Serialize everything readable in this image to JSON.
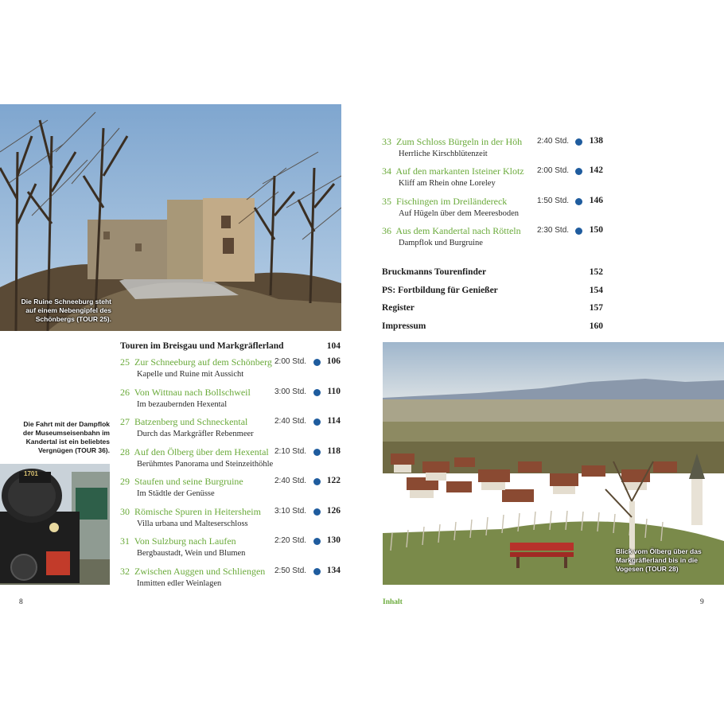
{
  "captions": {
    "ruine": "Die Ruine Schneeburg steht auf einem Nebengipfel des Schönbergs (TOUR 25).",
    "dampflok": "Die Fahrt mit der Dampflok der Museumseisenbahn im Kandertal ist ein beliebtes Vergnügen (TOUR 36).",
    "oelberg": "Blick vom Ölberg über das Markgräflerland bis in die Vogesen (TOUR 28)",
    "loco_number": "1701"
  },
  "left": {
    "section": {
      "title": "Touren im Breisgau und Markgräflerland",
      "page": "104"
    },
    "entries": [
      {
        "num": "25",
        "title": "Zur Schneeburg auf dem Schönberg",
        "subtitle": "Kapelle und Ruine mit Aussicht",
        "duration": "2:00 Std.",
        "page": "106"
      },
      {
        "num": "26",
        "title": "Von Wittnau nach Bollschweil",
        "subtitle": "Im bezaubernden Hexental",
        "duration": "3:00 Std.",
        "page": "110"
      },
      {
        "num": "27",
        "title": "Batzenberg und Schneckental",
        "subtitle": "Durch das Markgräfler Rebenmeer",
        "duration": "2:40 Std.",
        "page": "114"
      },
      {
        "num": "28",
        "title": "Auf den Ölberg über dem Hexental",
        "subtitle": "Berühmtes Panorama und Steinzeithöhle",
        "duration": "2:10 Std.",
        "page": "118"
      },
      {
        "num": "29",
        "title": "Staufen und seine Burgruine",
        "subtitle": "Im Städtle der Genüsse",
        "duration": "2:40 Std.",
        "page": "122"
      },
      {
        "num": "30",
        "title": "Römische Spuren in Heitersheim",
        "subtitle": "Villa urbana und Malteserschloss",
        "duration": "3:10 Std.",
        "page": "126"
      },
      {
        "num": "31",
        "title": "Von Sulzburg nach Laufen",
        "subtitle": "Bergbaustadt, Wein und Blumen",
        "duration": "2:20 Std.",
        "page": "130"
      },
      {
        "num": "32",
        "title": "Zwischen Auggen und Schliengen",
        "subtitle": "Inmitten edler Weinlagen",
        "duration": "2:50 Std.",
        "page": "134"
      }
    ],
    "folio": "8"
  },
  "right": {
    "entries": [
      {
        "num": "33",
        "title": "Zum Schloss Bürgeln in der Höh",
        "subtitle": "Herrliche Kirschblütenzeit",
        "duration": "2:40 Std.",
        "page": "138"
      },
      {
        "num": "34",
        "title": "Auf den markanten Isteiner Klotz",
        "subtitle": "Kliff am Rhein ohne Loreley",
        "duration": "2:00 Std.",
        "page": "142"
      },
      {
        "num": "35",
        "title": "Fischingen im Dreiländereck",
        "subtitle": "Auf Hügeln über dem Meeresboden",
        "duration": "1:50 Std.",
        "page": "146"
      },
      {
        "num": "36",
        "title": "Aus dem Kandertal nach Rötteln",
        "subtitle": "Dampflok und Burgruine",
        "duration": "2:30 Std.",
        "page": "150"
      }
    ],
    "extras": [
      {
        "title": "Bruckmanns Tourenfinder",
        "page": "152"
      },
      {
        "title": "PS: Fortbildung für Genießer",
        "page": "154"
      },
      {
        "title": "Register",
        "page": "157"
      },
      {
        "title": "Impressum",
        "page": "160"
      }
    ],
    "section_label": "Inhalt",
    "folio": "9"
  },
  "colors": {
    "title_green": "#6aaa3a",
    "difficulty_dot": "#1f5c9e"
  }
}
